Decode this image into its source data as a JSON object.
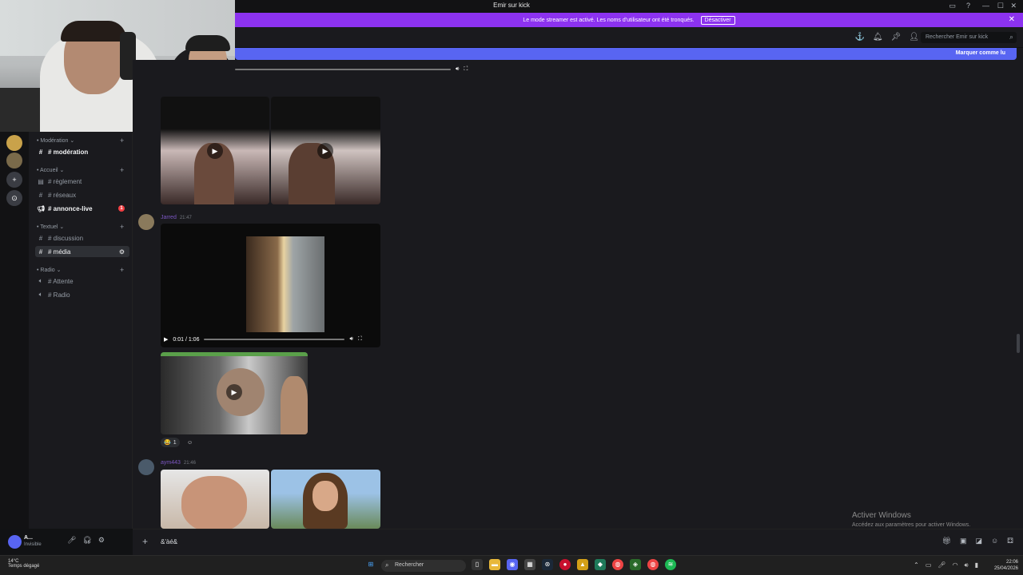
{
  "window": {
    "title": "Emir sur kick",
    "controls": [
      "▭",
      "?",
      "—",
      "☐",
      "✕"
    ]
  },
  "streamer_banner": {
    "text": "Le mode streamer est activé. Les noms d'utilisateur ont été tronqués.",
    "button": "Désactiver",
    "close": "✕"
  },
  "header": {
    "search_placeholder": "Rechercher Emir sur kick",
    "icons": [
      "threads-icon",
      "bell-icon",
      "pin-icon",
      "members-icon"
    ]
  },
  "new_messages_bar": {
    "label": "Marquer comme lu"
  },
  "sidebar": {
    "categories": [
      {
        "label": "• Modération ⌄",
        "channels": [
          {
            "label": "# modération",
            "bold": true
          }
        ]
      },
      {
        "label": "• Accueil ⌄",
        "channels": [
          {
            "label": "# règlement"
          },
          {
            "label": "# réseaux"
          },
          {
            "label": "# annonce-live",
            "bold": true,
            "badge": "1"
          }
        ]
      },
      {
        "label": "• Textuel ⌄",
        "channels": [
          {
            "label": "# discussion"
          },
          {
            "label": "# média",
            "active": true
          }
        ]
      },
      {
        "label": "• Radio ⌄",
        "channels": [
          {
            "label": "# Attente"
          },
          {
            "label": "# Radio"
          }
        ]
      }
    ]
  },
  "user_panel": {
    "name": "A...",
    "status": "Invisible"
  },
  "messages": [
    {
      "author": "Jarred",
      "time": "21:47",
      "video_time": "0:01 / 1:06"
    },
    {
      "reaction": {
        "emoji": "😂",
        "count": "1"
      }
    },
    {
      "author": "aym443",
      "time": "21:46"
    }
  ],
  "composer": {
    "text": "&'àé&"
  },
  "watermark": {
    "title": "Activer Windows",
    "subtitle": "Accédez aux paramètres pour activer Windows."
  },
  "taskbar": {
    "weather_temp": "14°C",
    "weather_desc": "Temps dégagé",
    "search_placeholder": "Rechercher",
    "time": "22:06",
    "date": "25/04/2026"
  },
  "colors": {
    "banner": "#8c32f0",
    "new_bar": "#5865f2",
    "bg": "#1a1a1e",
    "author": "#7c57c4"
  }
}
